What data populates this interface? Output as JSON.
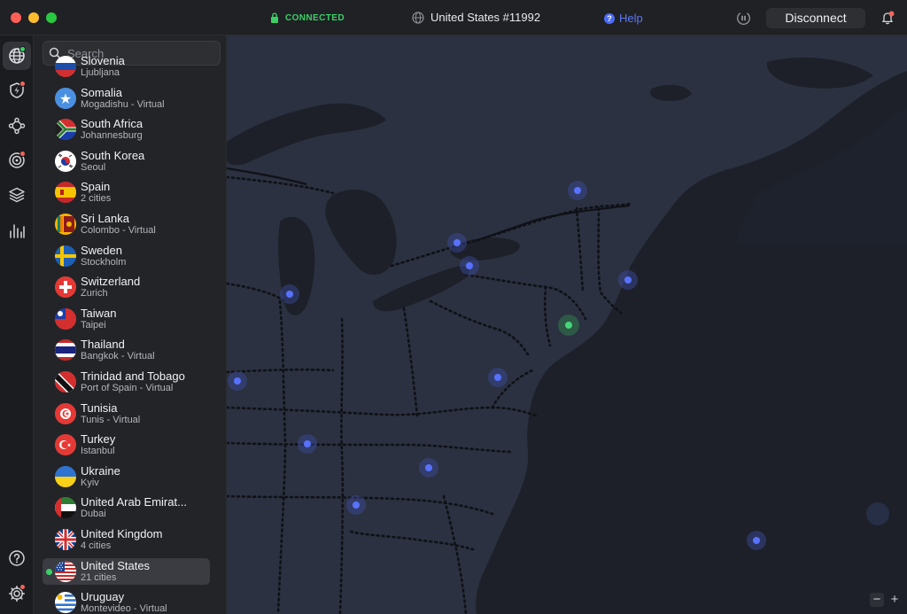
{
  "titlebar": {
    "status": "CONNECTED",
    "server": "United States #11992",
    "help": "Help",
    "disconnect": "Disconnect"
  },
  "search": {
    "placeholder": "Search",
    "value": ""
  },
  "countries": [
    {
      "name": "Slovenia",
      "sub": "Ljubljana",
      "flag": "slovenia"
    },
    {
      "name": "Somalia",
      "sub": "Mogadishu - Virtual",
      "flag": "somalia"
    },
    {
      "name": "South Africa",
      "sub": "Johannesburg",
      "flag": "south-africa"
    },
    {
      "name": "South Korea",
      "sub": "Seoul",
      "flag": "south-korea"
    },
    {
      "name": "Spain",
      "sub": "2 cities",
      "flag": "spain"
    },
    {
      "name": "Sri Lanka",
      "sub": "Colombo - Virtual",
      "flag": "sri-lanka"
    },
    {
      "name": "Sweden",
      "sub": "Stockholm",
      "flag": "sweden"
    },
    {
      "name": "Switzerland",
      "sub": "Zurich",
      "flag": "switzerland"
    },
    {
      "name": "Taiwan",
      "sub": "Taipei",
      "flag": "taiwan"
    },
    {
      "name": "Thailand",
      "sub": "Bangkok - Virtual",
      "flag": "thailand"
    },
    {
      "name": "Trinidad and Tobago",
      "sub": "Port of Spain - Virtual",
      "flag": "trinidad-and-tobago"
    },
    {
      "name": "Tunisia",
      "sub": "Tunis - Virtual",
      "flag": "tunisia"
    },
    {
      "name": "Turkey",
      "sub": "Istanbul",
      "flag": "turkey"
    },
    {
      "name": "Ukraine",
      "sub": "Kyiv",
      "flag": "ukraine"
    },
    {
      "name": "United Arab Emirat...",
      "sub": "Dubai",
      "flag": "uae"
    },
    {
      "name": "United Kingdom",
      "sub": "4 cities",
      "flag": "united-kingdom"
    },
    {
      "name": "United States",
      "sub": "21 cities",
      "flag": "united-states",
      "selected": true,
      "connected": true
    },
    {
      "name": "Uruguay",
      "sub": "Montevideo - Virtual",
      "flag": "uruguay"
    }
  ],
  "rail": [
    {
      "icon": "globe-icon",
      "active": true,
      "badge": "green"
    },
    {
      "icon": "shield-bolt-icon",
      "badge": "red"
    },
    {
      "icon": "meshnet-icon"
    },
    {
      "icon": "target-icon",
      "badge": "red"
    },
    {
      "icon": "layers-icon"
    },
    {
      "icon": "stats-icon"
    },
    {
      "icon": "help-circle-icon"
    },
    {
      "icon": "settings-icon",
      "badge": "red"
    }
  ],
  "zoom": {
    "out": "−",
    "in": "+"
  }
}
